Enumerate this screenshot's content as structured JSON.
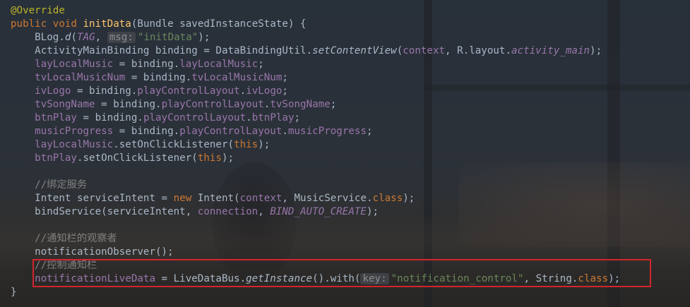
{
  "editor": {
    "line01": {
      "annotation": "@Override"
    },
    "line02": {
      "kw1": "public",
      "kw2": "void",
      "name": "initData",
      "rest": "(Bundle savedInstanceState) {"
    },
    "line03": {
      "a": "BLog.",
      "b": "d",
      "c": "(",
      "d": "TAG",
      "e": ", ",
      "hint": "msg:",
      "f": "\"initData\"",
      "g": ");"
    },
    "line04": {
      "a": "ActivityMainBinding binding = DataBindingUtil.",
      "b": "setContentView",
      "c": "(",
      "d": "context",
      "e": ", R.layout.",
      "f": "activity_main",
      "g": ");"
    },
    "line05": {
      "a": "layLocalMusic",
      "b": " = binding.",
      "c": "layLocalMusic",
      "d": ";"
    },
    "line06": {
      "a": "tvLocalMusicNum",
      "b": " = binding.",
      "c": "tvLocalMusicNum",
      "d": ";"
    },
    "line07": {
      "a": "ivLogo",
      "b": " = binding.",
      "c": "playControlLayout",
      "d": ".",
      "e": "ivLogo",
      "f": ";"
    },
    "line08": {
      "a": "tvSongName",
      "b": " = binding.",
      "c": "playControlLayout",
      "d": ".",
      "e": "tvSongName",
      "f": ";"
    },
    "line09": {
      "a": "btnPlay",
      "b": " = binding.",
      "c": "playControlLayout",
      "d": ".",
      "e": "btnPlay",
      "f": ";"
    },
    "line10": {
      "a": "musicProgress",
      "b": " = binding.",
      "c": "playControlLayout",
      "d": ".",
      "e": "musicProgress",
      "f": ";"
    },
    "line11": {
      "a": "layLocalMusic",
      "b": ".setOnClickListener(",
      "c": "this",
      "d": ");"
    },
    "line12": {
      "a": "btnPlay",
      "b": ".setOnClickListener(",
      "c": "this",
      "d": ");"
    },
    "line14": {
      "comment": "//绑定服务"
    },
    "line15": {
      "a": "Intent serviceIntent = ",
      "b": "new",
      "c": " Intent(",
      "d": "context",
      "e": ", MusicService.",
      "f": "class",
      "g": ");"
    },
    "line16": {
      "a": "bindService(serviceIntent, ",
      "b": "connection",
      "c": ", ",
      "d": "BIND_AUTO_CREATE",
      "e": ");"
    },
    "line18": {
      "comment": "//通知栏的观察者"
    },
    "line19": {
      "a": "notificationObserver();"
    },
    "line20": {
      "comment": "//控制通知栏"
    },
    "line21": {
      "a": "notificationLiveData",
      "b": " = LiveDataBus.",
      "c": "getInstance",
      "d": "().with(",
      "hint": "key:",
      "e": "\"notification_control\"",
      "f": ", String.",
      "g": "class",
      "h": ");"
    },
    "line22": {
      "a": "}"
    }
  },
  "colors": {
    "text": "#a9b7c6",
    "keyword": "#cc7832",
    "method_declaration": "#ffc66d",
    "field": "#9876aa",
    "string": "#6a8759",
    "comment": "#808080",
    "annotation": "#bbb529",
    "highlight_box": "#d0262c"
  }
}
